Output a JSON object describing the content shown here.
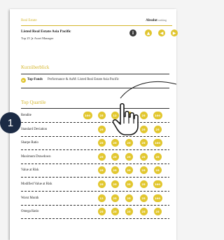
{
  "header": {
    "section": "Real Estate",
    "logo_main": "Absolut",
    "logo_sub": "ranking"
  },
  "title": "Listed Real Estate Asia Pacific",
  "subtitle": "Top 25 ⩾ Asset Manager",
  "toolbar": {
    "info_icon": "i",
    "up_icon": "▲",
    "prev_icon": "◀",
    "next_icon": "▶"
  },
  "kurzueberblick": {
    "heading": "Kurzüberblick",
    "topfonds_label": "Top-Fonds",
    "topfonds_text": "Performance & AuM: Listed Real Estate Asia Pacific"
  },
  "top_quartile": {
    "heading": "Top Quartile",
    "rows": [
      {
        "label": "Rendite",
        "values": [
          "100",
          "25",
          "12",
          "25",
          "25",
          "100"
        ]
      },
      {
        "label": "Standard Deviation",
        "values": [
          "",
          "25",
          "",
          "",
          "25",
          "25"
        ]
      },
      {
        "label": "Sharpe Ratio",
        "values": [
          "",
          "25",
          "25",
          "25",
          "25",
          "100"
        ]
      },
      {
        "label": "Maximum Drawdown",
        "values": [
          "",
          "25",
          "25",
          "25",
          "25",
          "25"
        ]
      },
      {
        "label": "Value at Risk",
        "values": [
          "",
          "25",
          "25",
          "25",
          "25",
          "25"
        ]
      },
      {
        "label": "Modified Value at Risk",
        "values": [
          "",
          "25",
          "25",
          "25",
          "25",
          "100"
        ]
      },
      {
        "label": "Worst Month",
        "values": [
          "",
          "12",
          "25",
          "25",
          "25",
          "100"
        ]
      },
      {
        "label": "Omega Ratio",
        "values": [
          "",
          "25",
          "25",
          "25",
          "25",
          "25"
        ]
      }
    ]
  },
  "step_marker": "1",
  "colors": {
    "accent": "#e2c72f",
    "heading_gold": "#d4b52a",
    "marker": "#1c2b45"
  }
}
